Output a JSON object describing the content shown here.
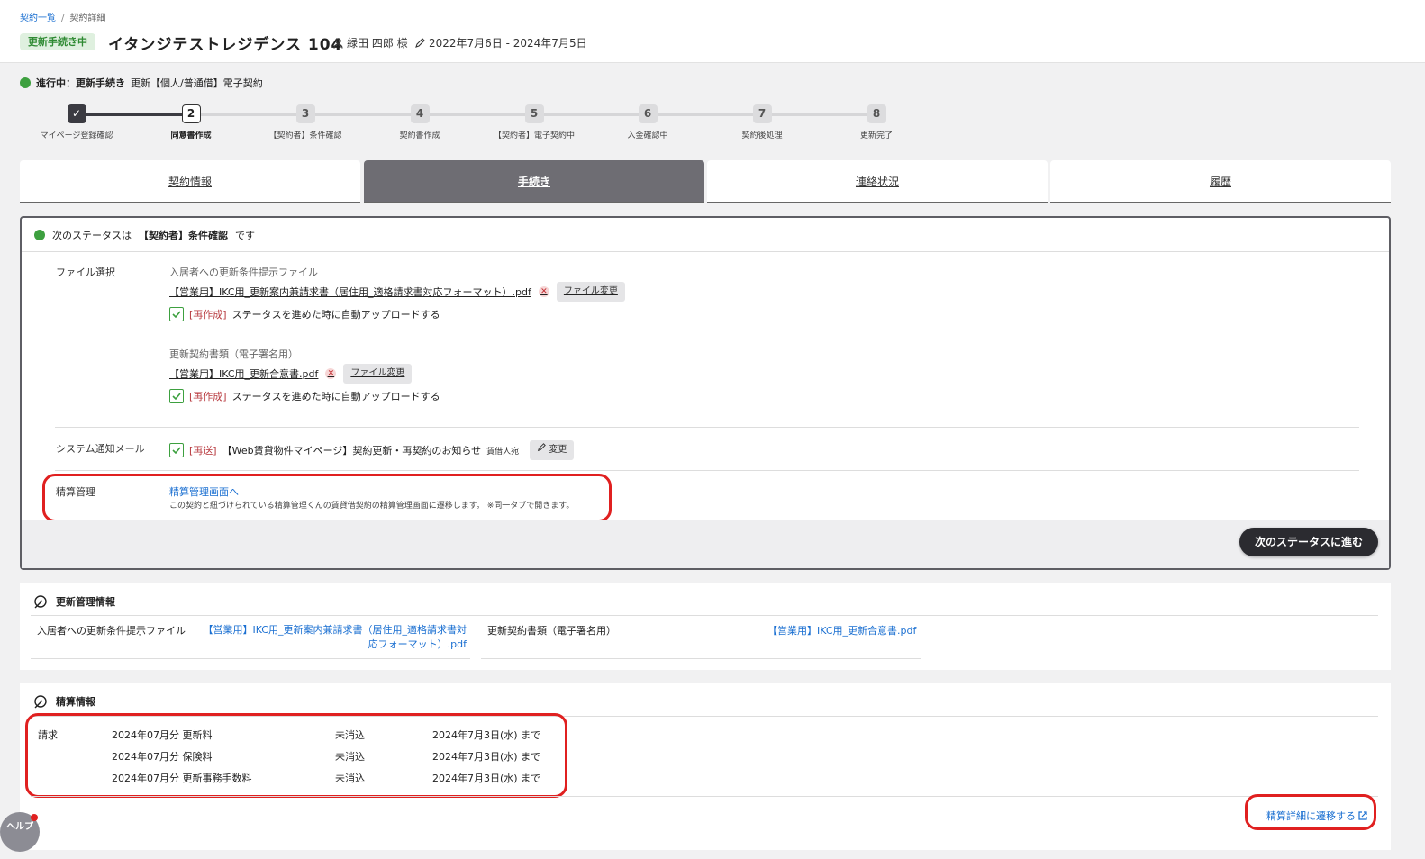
{
  "breadcrumb": {
    "parent": "契約一覧",
    "sep": "/",
    "current": "契約詳細"
  },
  "header": {
    "badge": "更新手続き中",
    "title": "イタンジテストレジデンス 104",
    "tenant": "緑田 四郎 様",
    "period": "2022年7月6日 - 2024年7月5日"
  },
  "progress": {
    "label": "進行中：更新手続き",
    "type": "更新【個人/普通借】電子契約",
    "steps": [
      {
        "num": "✓",
        "label": "マイページ登録確認",
        "state": "done"
      },
      {
        "num": "2",
        "label": "同意書作成",
        "state": "current"
      },
      {
        "num": "3",
        "label": "【契約者】条件確認",
        "state": "todo"
      },
      {
        "num": "4",
        "label": "契約書作成",
        "state": "todo"
      },
      {
        "num": "5",
        "label": "【契約者】電子契約中",
        "state": "todo"
      },
      {
        "num": "6",
        "label": "入金確認中",
        "state": "todo"
      },
      {
        "num": "7",
        "label": "契約後処理",
        "state": "todo"
      },
      {
        "num": "8",
        "label": "更新完了",
        "state": "todo"
      }
    ]
  },
  "tabs": [
    {
      "label": "契約情報",
      "active": false
    },
    {
      "label": "手続き",
      "active": true
    },
    {
      "label": "連絡状況",
      "active": false
    },
    {
      "label": "履歴",
      "active": false
    }
  ],
  "panel": {
    "next_prefix": "次のステータスは",
    "next_status": "【契約者】条件確認",
    "next_suffix": "です",
    "file_select_label": "ファイル選択",
    "file1_title": "入居者への更新条件提示ファイル",
    "file1_name": "【営業用】IKC用_更新案内兼請求書（居住用_適格請求書対応フォーマット）.pdf",
    "file2_title": "更新契約書類（電子署名用）",
    "file2_name": "【営業用】IKC用_更新合意書.pdf",
    "change_file": "ファイル変更",
    "regen_tag": "[再作成]",
    "regen_text": "ステータスを進めた時に自動アップロードする",
    "mail_label": "システム通知メール",
    "resend_tag": "[再送]",
    "mail_text": "【Web賃貸物件マイページ】契約更新・再契約のお知らせ",
    "mail_to": "賃借人宛",
    "change": "変更",
    "settle_label": "精算管理",
    "settle_link": "精算管理画面へ",
    "settle_note": "この契約と紐づけられている精算管理くんの賃貸借契約の精算管理画面に遷移します。 ※同一タブで開きます。",
    "next_button": "次のステータスに進む"
  },
  "renewal_info": {
    "title": "更新管理情報",
    "label1": "入居者への更新条件提示ファイル",
    "value1_line1": "【営業用】IKC用_更新案内兼請求書（居住用_適格請求書対",
    "value1_line2": "応フォーマット）.pdf",
    "label2": "更新契約書類（電子署名用）",
    "value2": "【営業用】IKC用_更新合意書.pdf"
  },
  "settlement_info": {
    "title": "精算情報",
    "row_label": "請求",
    "rows": [
      {
        "item": "2024年07月分 更新料",
        "status": "未消込",
        "due": "2024年7月3日(水) まで"
      },
      {
        "item": "2024年07月分 保険料",
        "status": "未消込",
        "due": "2024年7月3日(水) まで"
      },
      {
        "item": "2024年07月分 更新事務手数料",
        "status": "未消込",
        "due": "2024年7月3日(水) まで"
      }
    ],
    "detail_link": "精算詳細に遷移する"
  },
  "help": {
    "label": "ヘルプ"
  },
  "colors": {
    "accent": "#1a6fd1",
    "status_green": "#3da03f",
    "highlight": "#e02020",
    "dark": "#2b2b30"
  }
}
